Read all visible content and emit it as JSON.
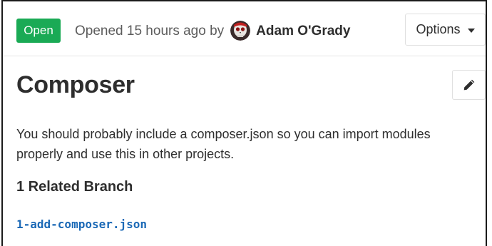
{
  "issue": {
    "status": "Open",
    "opened_text": "Opened 15 hours ago by",
    "author": "Adam O'Grady",
    "options_label": "Options",
    "title": "Composer",
    "description": "You should probably include a composer.json so you can import modules properly and use this in other projects.",
    "related_branches_heading": "1 Related Branch",
    "related_branches": [
      {
        "name": "1-add-composer.json"
      }
    ]
  },
  "colors": {
    "status_open": "#1aaa55",
    "link": "#1b69b6",
    "text": "#2e2e2e",
    "muted": "#5c5c5c"
  },
  "icons": {
    "avatar": "skull-avatar",
    "options_caret": "caret-down-icon",
    "edit": "pencil-icon"
  }
}
